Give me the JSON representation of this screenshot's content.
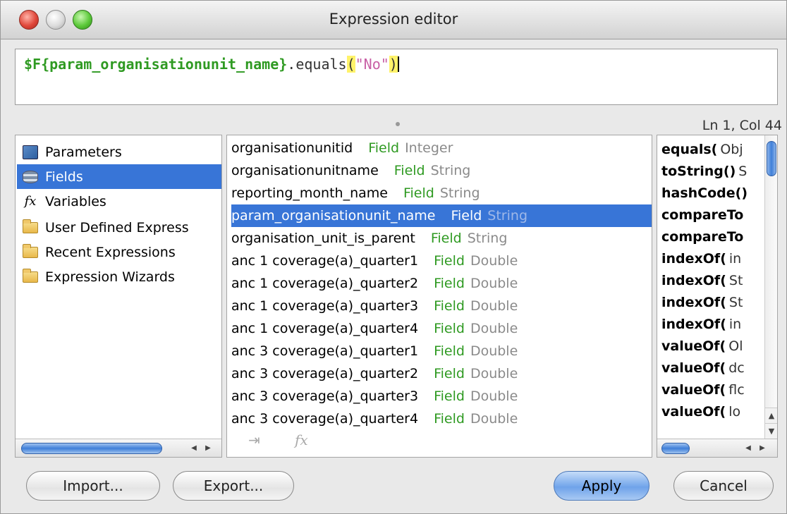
{
  "window": {
    "title": "Expression editor"
  },
  "editor": {
    "expression_field": "$F{param_organisationunit_name}",
    "expression_method": ".equals",
    "paren_open": "(",
    "string_literal": "\"No\"",
    "paren_close": ")",
    "cursor_position": "Ln 1, Col 44"
  },
  "categories": [
    {
      "label": "Parameters",
      "icon": "parameters-icon"
    },
    {
      "label": "Fields",
      "icon": "fields-icon",
      "selected": true
    },
    {
      "label": "Variables",
      "icon": "fx-icon"
    },
    {
      "label": "User Defined Express",
      "icon": "folder-icon"
    },
    {
      "label": "Recent Expressions",
      "icon": "folder-icon"
    },
    {
      "label": "Expression Wizards",
      "icon": "folder-icon"
    }
  ],
  "fields": [
    {
      "name": "organisationunitid",
      "kind": "Field",
      "type": "Integer"
    },
    {
      "name": "organisationunitname",
      "kind": "Field",
      "type": "String"
    },
    {
      "name": "reporting_month_name",
      "kind": "Field",
      "type": "String"
    },
    {
      "name": "param_organisationunit_name",
      "kind": "Field",
      "type": "String",
      "selected": true
    },
    {
      "name": "organisation_unit_is_parent",
      "kind": "Field",
      "type": "String"
    },
    {
      "name": "anc 1 coverage(a)_quarter1",
      "kind": "Field",
      "type": "Double"
    },
    {
      "name": "anc 1 coverage(a)_quarter2",
      "kind": "Field",
      "type": "Double"
    },
    {
      "name": "anc 1 coverage(a)_quarter3",
      "kind": "Field",
      "type": "Double"
    },
    {
      "name": "anc 1 coverage(a)_quarter4",
      "kind": "Field",
      "type": "Double"
    },
    {
      "name": "anc 3 coverage(a)_quarter1",
      "kind": "Field",
      "type": "Double"
    },
    {
      "name": "anc 3 coverage(a)_quarter2",
      "kind": "Field",
      "type": "Double"
    },
    {
      "name": "anc 3 coverage(a)_quarter3",
      "kind": "Field",
      "type": "Double"
    },
    {
      "name": "anc 3 coverage(a)_quarter4",
      "kind": "Field",
      "type": "Double"
    }
  ],
  "methods": [
    {
      "name": "equals(",
      "sig": "Obj"
    },
    {
      "name": "toString()",
      "sig": "S"
    },
    {
      "name": "hashCode()",
      "sig": ""
    },
    {
      "name": "compareTo",
      "sig": ""
    },
    {
      "name": "compareTo",
      "sig": ""
    },
    {
      "name": "indexOf(",
      "sig": "in"
    },
    {
      "name": "indexOf(",
      "sig": "St"
    },
    {
      "name": "indexOf(",
      "sig": "St"
    },
    {
      "name": "indexOf(",
      "sig": "in"
    },
    {
      "name": "valueOf(",
      "sig": "Ol"
    },
    {
      "name": "valueOf(",
      "sig": "dc"
    },
    {
      "name": "valueOf(",
      "sig": "flc"
    },
    {
      "name": "valueOf(",
      "sig": "lo"
    }
  ],
  "buttons": {
    "import": "Import...",
    "export": "Export...",
    "apply": "Apply",
    "cancel": "Cancel"
  },
  "colors": {
    "selection": "#3875d7",
    "field_kind": "#2f9a22",
    "type_text": "#8a8a8a",
    "string_literal": "#c85fa5",
    "bracket_highlight": "#fff36a"
  }
}
